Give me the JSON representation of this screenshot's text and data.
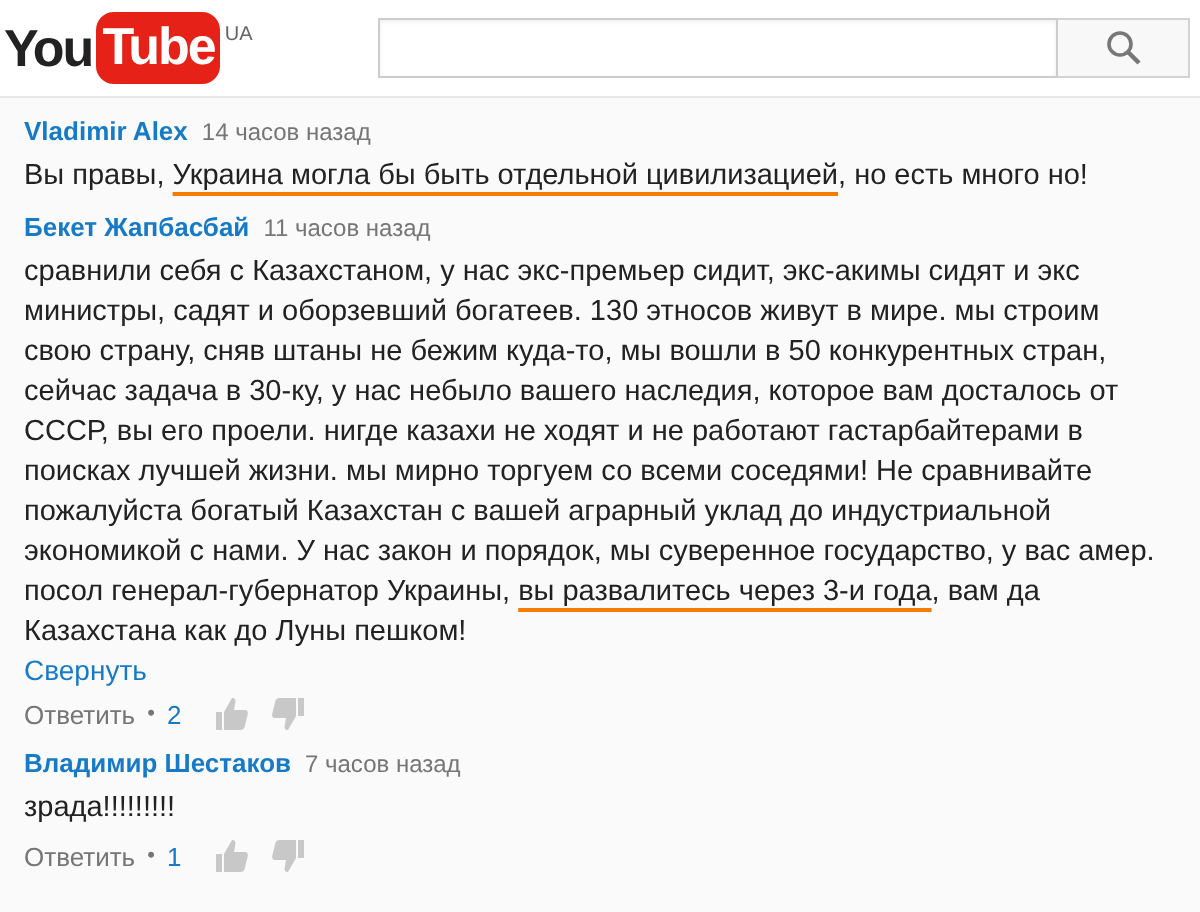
{
  "header": {
    "logo": {
      "you": "You",
      "tube": "Tube",
      "region": "UA"
    }
  },
  "comments": [
    {
      "author": "Vladimir Alex",
      "time": "14 часов назад",
      "body": [
        {
          "text": "Вы правы, ",
          "underlined": false
        },
        {
          "text": "Украина могла бы быть отдельной цивилизацией",
          "underlined": true
        },
        {
          "text": ", но есть много но!",
          "underlined": false
        }
      ]
    },
    {
      "author": "Бекет Жапбасбай",
      "time": "11 часов назад",
      "body": [
        {
          "text": "сравнили себя с Казахстаном, у нас экс-премьер сидит, экс-акимы  сидят и экс\nминистры, садят и оборзевший богатеев. 130 этносов живут в мире. мы строим\nсвою страну, сняв штаны не бежим куда-то, мы вошли в 50 конкурентных стран,\nсейчас задача в 30-ку, у нас небыло вашего наследия, которое вам досталось от\nСССР, вы его проели. нигде казахи не ходят и не работают гастарбайтерами в\nпоисках лучшей жизни. мы мирно торгуем со всеми соседями! Не сравнивайте\nпожалуйста богатый Казахстан с вашей аграрный уклад до индустриальной\nэкономикой с нами. У нас закон и порядок, мы суверенное государство, у вас амер.\nпосол генерал-губернатор Украины, ",
          "underlined": false
        },
        {
          "text": "вы развалитесь через 3-и года",
          "underlined": true
        },
        {
          "text": ", вам да\nКазахстана как до Луны пешком!",
          "underlined": false
        }
      ],
      "collapse": "Свернуть",
      "reply": "Ответить",
      "separator": "•",
      "replies": "2"
    },
    {
      "author": "Владимир Шестаков",
      "time": "7 часов назад",
      "body": [
        {
          "text": "зрада!!!!!!!!!",
          "underlined": false
        }
      ],
      "reply": "Ответить",
      "separator": "•",
      "replies": "1"
    }
  ]
}
